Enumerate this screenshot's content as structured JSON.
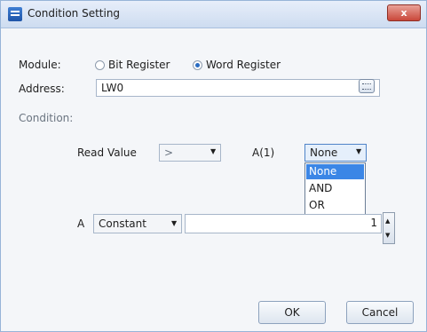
{
  "window": {
    "title": "Condition Setting",
    "close_symbol": "x"
  },
  "module": {
    "label": "Module:",
    "options": [
      {
        "label": "Bit Register",
        "selected": false
      },
      {
        "label": "Word Register",
        "selected": true
      }
    ]
  },
  "address": {
    "label": "Address:",
    "value": "LW0"
  },
  "condition": {
    "label": "Condition:",
    "read_value_label": "Read Value",
    "operator_value": ">",
    "a1_label": "A(1)",
    "logic_value": "None",
    "logic_options": [
      "None",
      "AND",
      "OR"
    ]
  },
  "operand": {
    "label": "A",
    "source_value": "Constant",
    "constant_value": "1"
  },
  "buttons": {
    "ok": "OK",
    "cancel": "Cancel"
  },
  "colors": {
    "title_bar": "#cddcf0",
    "selection": "#3b86e6",
    "close_button": "#c9473a"
  }
}
